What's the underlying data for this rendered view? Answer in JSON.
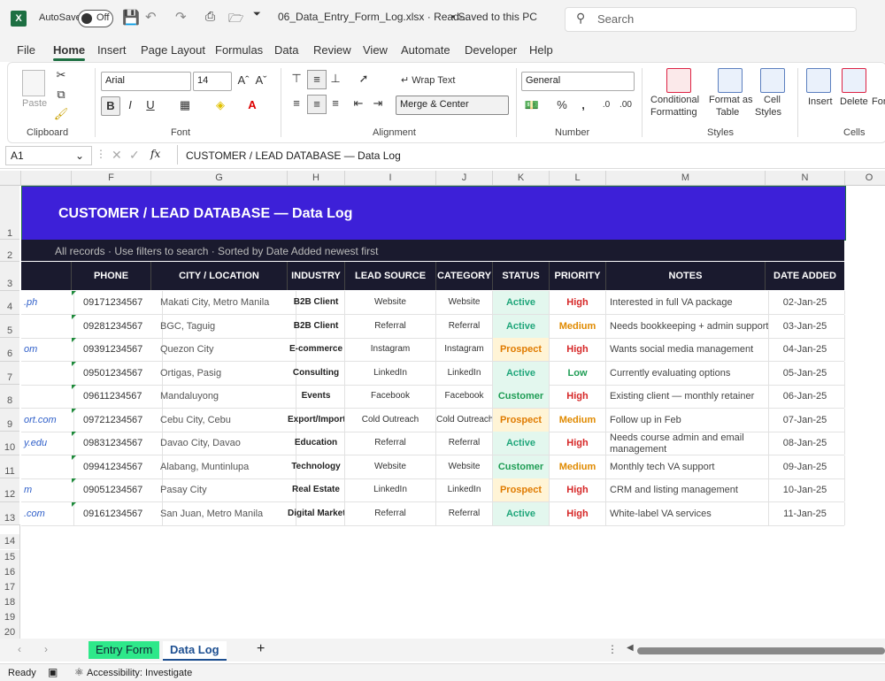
{
  "titlebar": {
    "app_icon": "X",
    "autosave_label": "AutoSave",
    "autosave_state": "Off",
    "filename": "06_Data_Entry_Form_Log.xlsx  ·  Read-...",
    "save_status": "•  Saved to this PC",
    "search_placeholder": "Search"
  },
  "menu": [
    "File",
    "Home",
    "Insert",
    "Page Layout",
    "Formulas",
    "Data",
    "Review",
    "View",
    "Automate",
    "Developer",
    "Help"
  ],
  "ribbon": {
    "clipboard": {
      "paste": "Paste",
      "label": "Clipboard"
    },
    "font": {
      "name": "Arial",
      "size": "14",
      "bold": "B",
      "italic": "I",
      "underline": "U",
      "label": "Font"
    },
    "alignment": {
      "wrap": "Wrap Text",
      "merge": "Merge & Center",
      "label": "Alignment"
    },
    "number": {
      "format": "General",
      "label": "Number"
    },
    "styles": {
      "conditional": "Conditional",
      "formatting": "Formatting",
      "format_as": "Format as",
      "table": "Table",
      "cell": "Cell",
      "cell_styles": "Styles",
      "label": "Styles"
    },
    "cells": {
      "insert": "Insert",
      "delete": "Delete",
      "format": "For",
      "label": "Cells"
    }
  },
  "formula": {
    "cell_ref": "A1",
    "fx": "fx",
    "content": "CUSTOMER / LEAD DATABASE — Data Log"
  },
  "columns": [
    "F",
    "G",
    "H",
    "I",
    "J",
    "K",
    "L",
    "M",
    "N",
    "O"
  ],
  "rows": [
    "1",
    "2",
    "3",
    "4",
    "5",
    "6",
    "7",
    "8",
    "9",
    "10",
    "11",
    "12",
    "13",
    "14",
    "15",
    "16",
    "17",
    "18",
    "19",
    "20"
  ],
  "sheet": {
    "title": "CUSTOMER / LEAD DATABASE  —  Data Log",
    "subtitle": "All records · Use filters to search · Sorted by Date Added newest first",
    "headers": [
      "PHONE",
      "CITY / LOCATION",
      "INDUSTRY",
      "LEAD SOURCE",
      "CATEGORY",
      "STATUS",
      "PRIORITY",
      "NOTES",
      "DATE ADDED"
    ],
    "records": [
      {
        "email": ".ph",
        "phone": "09171234567",
        "city": "Makati City, Metro Manila",
        "industry": "B2B Client",
        "source": "Website",
        "category": "Website",
        "status": "Active",
        "priority": "High",
        "notes": "Interested in full VA package",
        "date": "02-Jan-25"
      },
      {
        "email": "",
        "phone": "09281234567",
        "city": "BGC, Taguig",
        "industry": "B2B Client",
        "source": "Referral",
        "category": "Referral",
        "status": "Active",
        "priority": "Medium",
        "notes": "Needs bookkeeping + admin support",
        "date": "03-Jan-25"
      },
      {
        "email": "om",
        "phone": "09391234567",
        "city": "Quezon City",
        "industry": "E-commerce",
        "source": "Instagram",
        "category": "Instagram",
        "status": "Prospect",
        "priority": "High",
        "notes": "Wants social media management",
        "date": "04-Jan-25"
      },
      {
        "email": "",
        "phone": "09501234567",
        "city": "Ortigas, Pasig",
        "industry": "Consulting",
        "source": "LinkedIn",
        "category": "LinkedIn",
        "status": "Active",
        "priority": "Low",
        "notes": "Currently evaluating options",
        "date": "05-Jan-25"
      },
      {
        "email": "",
        "phone": "09611234567",
        "city": "Mandaluyong",
        "industry": "Events",
        "source": "Facebook",
        "category": "Facebook",
        "status": "Customer",
        "priority": "High",
        "notes": "Existing client — monthly retainer",
        "date": "06-Jan-25"
      },
      {
        "email": "ort.com",
        "phone": "09721234567",
        "city": "Cebu City, Cebu",
        "industry": "Export/Import",
        "source": "Cold Outreach",
        "category": "Cold Outreach",
        "status": "Prospect",
        "priority": "Medium",
        "notes": "Follow up in Feb",
        "date": "07-Jan-25"
      },
      {
        "email": "y.edu",
        "phone": "09831234567",
        "city": "Davao City, Davao",
        "industry": "Education",
        "source": "Referral",
        "category": "Referral",
        "status": "Active",
        "priority": "High",
        "notes": "Needs course admin and email management",
        "date": "08-Jan-25"
      },
      {
        "email": "",
        "phone": "09941234567",
        "city": "Alabang, Muntinlupa",
        "industry": "Technology",
        "source": "Website",
        "category": "Website",
        "status": "Customer",
        "priority": "Medium",
        "notes": "Monthly tech VA support",
        "date": "09-Jan-25"
      },
      {
        "email": "m",
        "phone": "09051234567",
        "city": "Pasay City",
        "industry": "Real Estate",
        "source": "LinkedIn",
        "category": "LinkedIn",
        "status": "Prospect",
        "priority": "High",
        "notes": "CRM and listing management",
        "date": "10-Jan-25"
      },
      {
        "email": ".com",
        "phone": "09161234567",
        "city": "San Juan, Metro Manila",
        "industry": "Digital Marketing",
        "source": "Referral",
        "category": "Referral",
        "status": "Active",
        "priority": "High",
        "notes": "White-label VA services",
        "date": "11-Jan-25"
      }
    ]
  },
  "status_colors": {
    "Active": {
      "fg": "#1fa67a",
      "bg": "#e3f7ee"
    },
    "Prospect": {
      "fg": "#e07b00",
      "bg": "#fff4d6"
    },
    "Customer": {
      "fg": "#1f9d55",
      "bg": "#e3f7ee"
    }
  },
  "priority_colors": {
    "High": "#d62828",
    "Medium": "#e08a00",
    "Low": "#1f9d55"
  },
  "tabs": {
    "entry_form": "Entry Form",
    "data_log": "Data Log",
    "add": "+"
  },
  "statusbar": {
    "ready": "Ready",
    "accessibility": "Accessibility: Investigate"
  }
}
